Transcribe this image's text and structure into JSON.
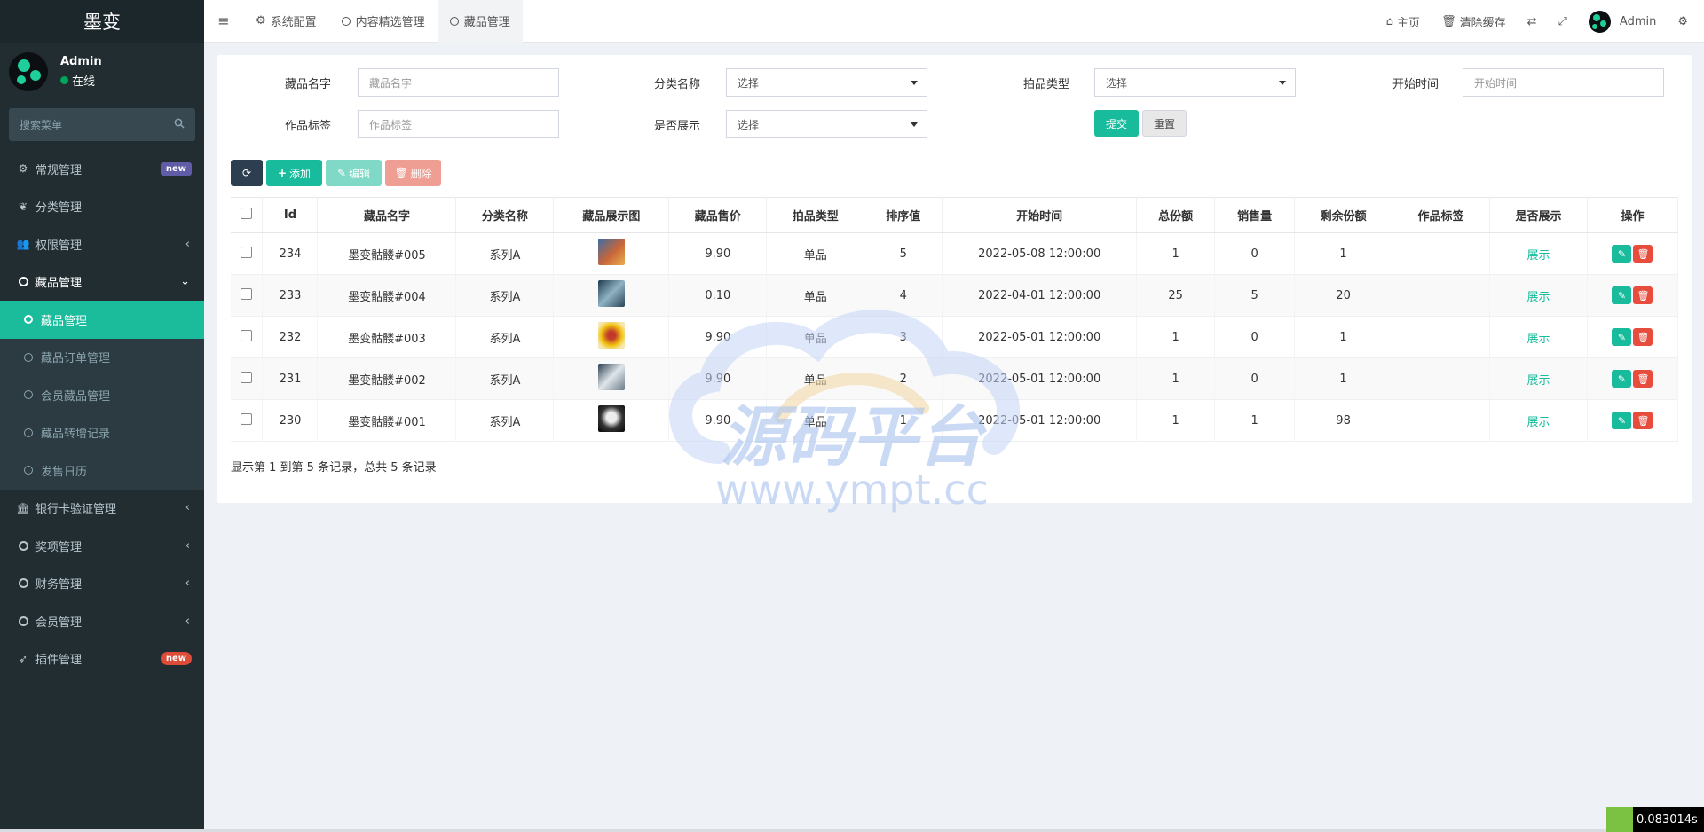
{
  "sidebar": {
    "brand": "墨变",
    "user": {
      "name": "Admin",
      "status": "在线"
    },
    "search_placeholder": "搜索菜单",
    "menu": [
      {
        "label": "常规管理",
        "icon": "cogs-icon",
        "badge": "new"
      },
      {
        "label": "分类管理",
        "icon": "leaf-icon"
      },
      {
        "label": "权限管理",
        "icon": "group-icon",
        "chevron": "‹"
      },
      {
        "label": "藏品管理",
        "icon": "circle-icon",
        "chevron": "⌄"
      }
    ],
    "submenu": [
      {
        "label": "藏品管理",
        "active": true
      },
      {
        "label": "藏品订单管理"
      },
      {
        "label": "会员藏品管理"
      },
      {
        "label": "藏品转增记录"
      },
      {
        "label": "发售日历"
      }
    ],
    "menu2": [
      {
        "label": "银行卡验证管理",
        "icon": "bank-icon",
        "chevron": "‹"
      },
      {
        "label": "奖项管理",
        "icon": "circle-icon",
        "chevron": "‹"
      },
      {
        "label": "财务管理",
        "icon": "circle-icon",
        "chevron": "‹"
      },
      {
        "label": "会员管理",
        "icon": "circle-icon",
        "chevron": "‹"
      },
      {
        "label": "插件管理",
        "icon": "rocket-icon",
        "badge": "new"
      }
    ]
  },
  "header": {
    "tabs": [
      "系统配置",
      "内容精选管理",
      "藏品管理"
    ],
    "home": "主页",
    "clear_cache": "清除缓存",
    "user": "Admin"
  },
  "filters": {
    "name_label": "藏品名字",
    "name_placeholder": "藏品名字",
    "category_label": "分类名称",
    "category_value": "选择",
    "auction_label": "拍品类型",
    "auction_value": "选择",
    "start_label": "开始时间",
    "start_placeholder": "开始时间",
    "tag_label": "作品标签",
    "tag_placeholder": "作品标签",
    "show_label": "是否展示",
    "show_value": "选择",
    "submit": "提交",
    "reset": "重置"
  },
  "toolbar": {
    "add": "添加",
    "edit": "编辑",
    "delete": "删除"
  },
  "table": {
    "headers": [
      "Id",
      "藏品名字",
      "分类名称",
      "藏品展示图",
      "藏品售价",
      "拍品类型",
      "排序值",
      "开始时间",
      "总份额",
      "销售量",
      "剩余份额",
      "作品标签",
      "是否展示",
      "操作"
    ],
    "rows": [
      {
        "id": "234",
        "name": "墨变骷髅#005",
        "category": "系列A",
        "price": "9.90",
        "type": "单品",
        "sort": "5",
        "start": "2022-05-08 12:00:00",
        "total": "1",
        "sold": "0",
        "remain": "1",
        "tag": "",
        "show": "展示",
        "thumb": "#c9663a"
      },
      {
        "id": "233",
        "name": "墨变骷髅#004",
        "category": "系列A",
        "price": "0.10",
        "type": "单品",
        "sort": "4",
        "start": "2022-04-01 12:00:00",
        "total": "25",
        "sold": "5",
        "remain": "20",
        "tag": "",
        "show": "展示",
        "thumb": "#4a6a7a"
      },
      {
        "id": "232",
        "name": "墨变骷髅#003",
        "category": "系列A",
        "price": "9.90",
        "type": "单品",
        "sort": "3",
        "start": "2022-05-01 12:00:00",
        "total": "1",
        "sold": "0",
        "remain": "1",
        "tag": "",
        "show": "展示",
        "thumb": "#e0a040"
      },
      {
        "id": "231",
        "name": "墨变骷髅#002",
        "category": "系列A",
        "price": "9.90",
        "type": "单品",
        "sort": "2",
        "start": "2022-05-01 12:00:00",
        "total": "1",
        "sold": "0",
        "remain": "1",
        "tag": "",
        "show": "展示",
        "thumb": "#7f8a96"
      },
      {
        "id": "230",
        "name": "墨变骷髅#001",
        "category": "系列A",
        "price": "9.90",
        "type": "单品",
        "sort": "1",
        "start": "2022-05-01 12:00:00",
        "total": "1",
        "sold": "1",
        "remain": "98",
        "tag": "",
        "show": "展示",
        "thumb": "#555555"
      }
    ]
  },
  "pager": "显示第 1 到第 5 条记录，总共 5 条记录",
  "watermark": {
    "title": "源码平台",
    "url": "www.ympt.cc"
  },
  "timer": "0.083014s",
  "colors": {
    "accent": "#18bc9c",
    "sidebar": "#222d32",
    "danger": "#e74c3c"
  }
}
